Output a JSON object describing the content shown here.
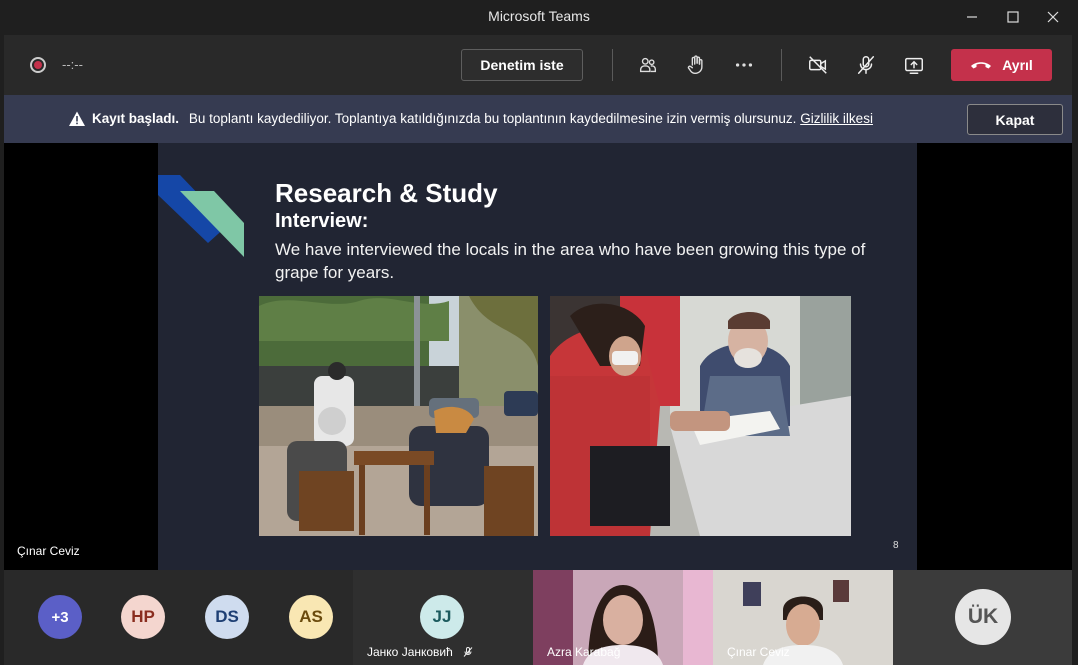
{
  "window": {
    "title": "Microsoft Teams"
  },
  "toolbar": {
    "timer": "--:--",
    "control_label": "Denetim iste",
    "leave_label": "Ayrıl"
  },
  "banner": {
    "title": "Kayıt başladı.",
    "message": "Bu toplantı kaydediliyor. Toplantıya katıldığınızda bu toplantının kaydedilmesine izin vermiş olursunuz.",
    "link": "Gizlilik ilkesi",
    "close_label": "Kapat"
  },
  "slide": {
    "heading": "Research & Study",
    "subheading": "Interview:",
    "body": "We have interviewed the locals in the area who have been growing this type of grape for years.",
    "page_number": "8"
  },
  "presenter": {
    "name": "Çınar Ceviz"
  },
  "participants": {
    "more": "+3",
    "avatars": [
      {
        "initials": "HP",
        "bg": "#f4d6cf",
        "fg": "#8a2d1f"
      },
      {
        "initials": "DS",
        "bg": "#cfdcef",
        "fg": "#1e3f74"
      },
      {
        "initials": "AS",
        "bg": "#f9e7b3",
        "fg": "#6b4b0d"
      }
    ],
    "jj": {
      "initials": "JJ",
      "name": "Јанко Јанковић"
    },
    "video1": {
      "name": "Azra Karabağ"
    },
    "video2": {
      "name": "Çınar Ceviz"
    },
    "uk": {
      "initials": "ÜK"
    }
  },
  "colors": {
    "leave": "#c4314b",
    "banner": "#363b51",
    "more_avatar": "#5b5fc7"
  }
}
